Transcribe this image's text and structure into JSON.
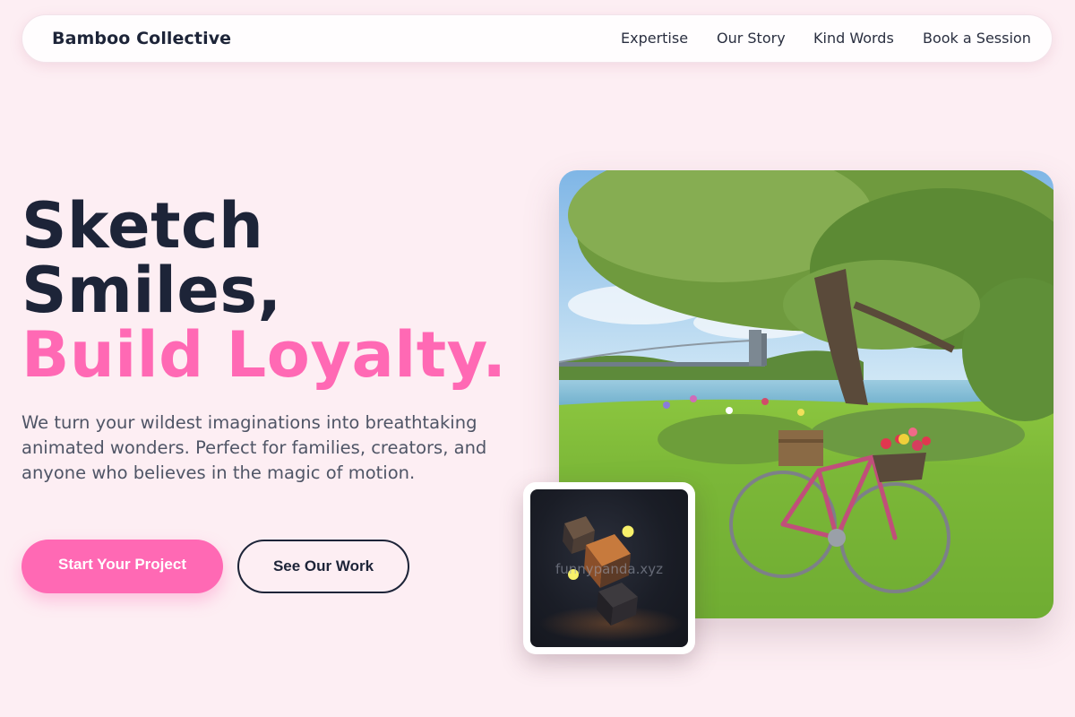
{
  "nav": {
    "brand": "Bamboo Collective",
    "links": [
      "Expertise",
      "Our Story",
      "Kind Words",
      "Book a Session"
    ]
  },
  "hero": {
    "headline_line1": "Sketch",
    "headline_line2": "Smiles,",
    "headline_accent": "Build Loyalty.",
    "subtext": "We turn your wildest imaginations into breathtaking animated wonders. Perfect for families, creators, and anyone who believes in the magic of motion.",
    "primary_cta": "Start Your Project",
    "secondary_cta": "See Our Work",
    "inset_watermark": "funnypanda.xyz"
  },
  "colors": {
    "background": "#fdeef3",
    "accent": "#ff69b4",
    "text_dark": "#1d2438",
    "text_muted": "#4f5566"
  },
  "icons": {
    "hero_photo": "bicycle-in-park-photo",
    "inset_render": "floating-cubes-render"
  }
}
